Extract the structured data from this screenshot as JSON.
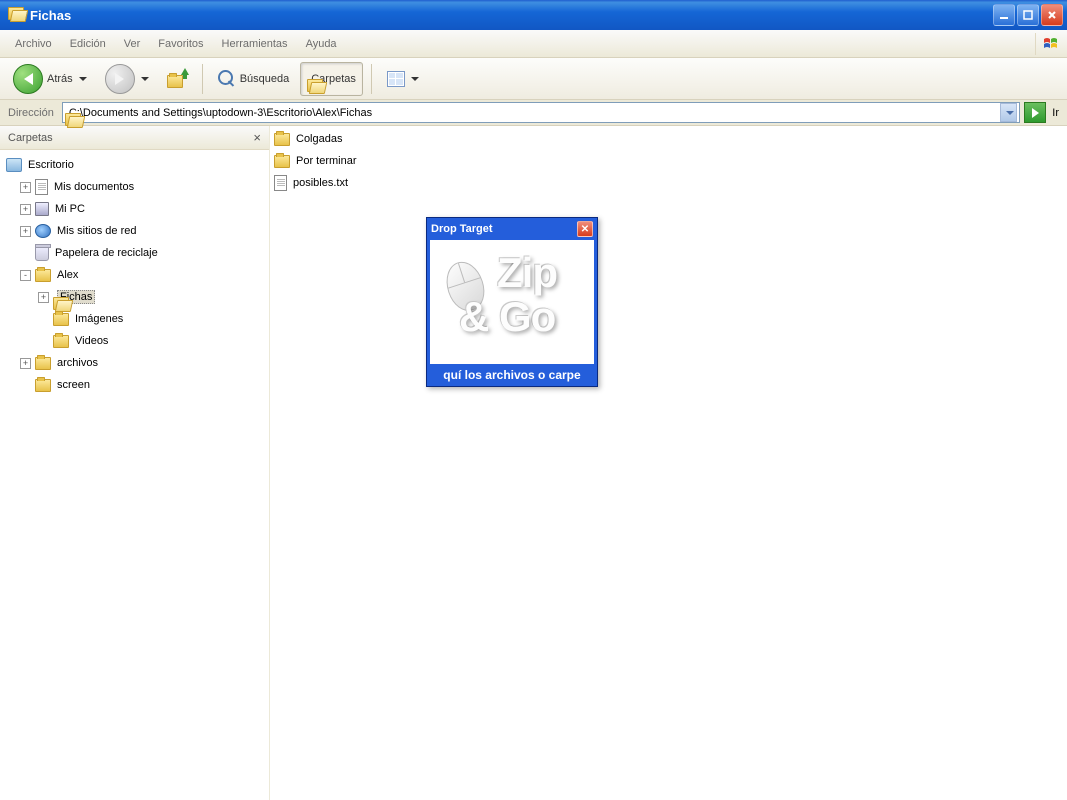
{
  "window": {
    "title": "Fichas"
  },
  "menubar": {
    "items": [
      "Archivo",
      "Edición",
      "Ver",
      "Favoritos",
      "Herramientas",
      "Ayuda"
    ]
  },
  "toolbar": {
    "back": "Atrás",
    "search": "Búsqueda",
    "folders": "Carpetas"
  },
  "addressbar": {
    "label": "Dirección",
    "path": "C:\\Documents and Settings\\uptodown-3\\Escritorio\\Alex\\Fichas",
    "go": "Ir"
  },
  "sidebar": {
    "title": "Carpetas",
    "tree": {
      "root": "Escritorio",
      "items": [
        {
          "label": "Mis documentos",
          "expander": "+",
          "icon": "doc"
        },
        {
          "label": "Mi PC",
          "expander": "+",
          "icon": "pc"
        },
        {
          "label": "Mis sitios de red",
          "expander": "+",
          "icon": "net"
        },
        {
          "label": "Papelera de reciclaje",
          "expander": "",
          "icon": "recycle"
        },
        {
          "label": "Alex",
          "expander": "-",
          "icon": "folder"
        },
        {
          "label": "archivos",
          "expander": "+",
          "icon": "folder"
        },
        {
          "label": "screen",
          "expander": "",
          "icon": "folder"
        }
      ],
      "alex_children": [
        {
          "label": "Fichas",
          "expander": "+",
          "selected": true
        },
        {
          "label": "Imágenes",
          "expander": ""
        },
        {
          "label": "Videos",
          "expander": ""
        }
      ]
    }
  },
  "content": {
    "items": [
      {
        "label": "Colgadas",
        "type": "folder"
      },
      {
        "label": "Por terminar",
        "type": "folder"
      },
      {
        "label": "posibles.txt",
        "type": "file"
      }
    ]
  },
  "drop_target": {
    "title": "Drop Target",
    "logo_line1": "Zip",
    "logo_line2": "& Go",
    "status": "quí los archivos o carpe"
  }
}
